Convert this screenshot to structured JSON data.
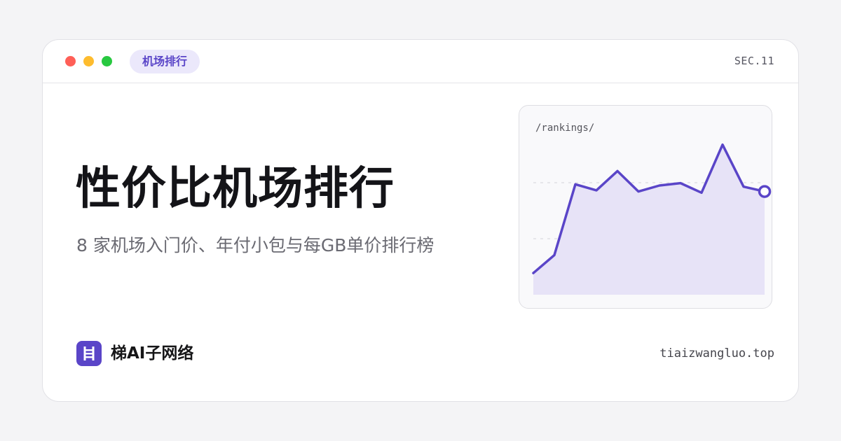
{
  "window": {
    "tag_label": "机场排行",
    "section_code": "SEC.11"
  },
  "hero": {
    "title": "性价比机场排行",
    "subtitle": "8 家机场入门价、年付小包与每GB单价排行榜"
  },
  "chart_data": {
    "type": "area",
    "path_label": "/rankings/",
    "values": [
      0.18,
      0.33,
      0.92,
      0.87,
      1.03,
      0.86,
      0.91,
      0.93,
      0.85,
      1.25,
      0.9,
      0.86
    ],
    "ylim": [
      0,
      1.4
    ],
    "grid": true,
    "line_color": "#5a45c8",
    "fill_color": "#e7e3f7"
  },
  "footer": {
    "brand_name": "梯AI子网络",
    "logo_icon": "ladder-icon",
    "domain": "tiaizwangluo.top"
  },
  "colors": {
    "accent": "#5a45c8",
    "tag_text": "#5a45c8",
    "dot_red": "#ff5f57",
    "dot_yellow": "#febc2e",
    "dot_green": "#28c840"
  }
}
